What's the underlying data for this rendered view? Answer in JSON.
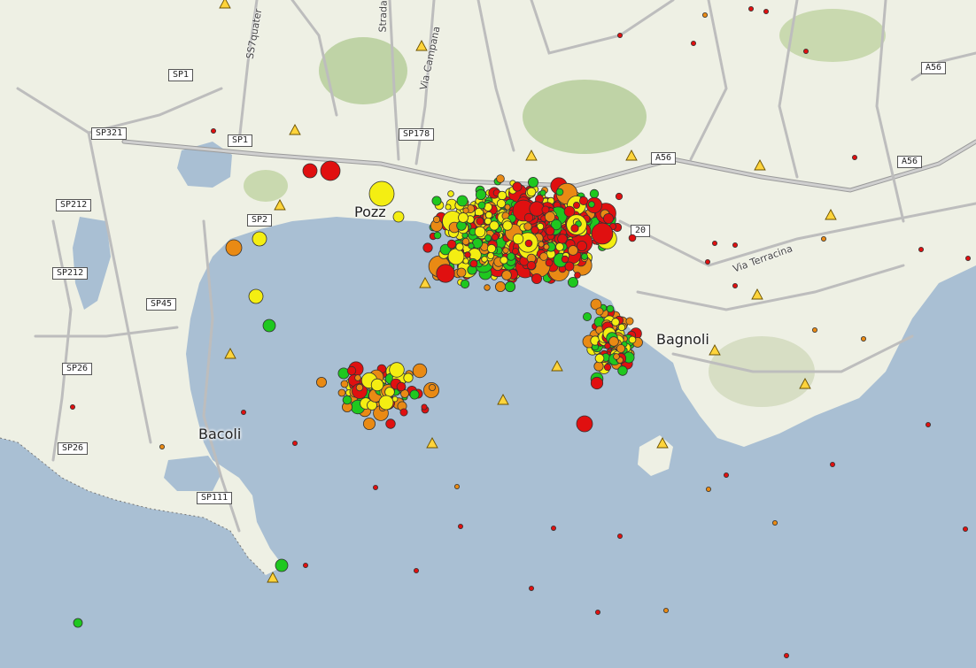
{
  "map": {
    "road_labels": [
      {
        "id": "sp1-a",
        "text": "SP1"
      },
      {
        "id": "sp1-b",
        "text": "SP1"
      },
      {
        "id": "sp321",
        "text": "SP321"
      },
      {
        "id": "sp212-a",
        "text": "SP212"
      },
      {
        "id": "sp212-b",
        "text": "SP212"
      },
      {
        "id": "sp2",
        "text": "SP2"
      },
      {
        "id": "sp45",
        "text": "SP45"
      },
      {
        "id": "sp26-a",
        "text": "SP26"
      },
      {
        "id": "sp26-b",
        "text": "SP26"
      },
      {
        "id": "sp111",
        "text": "SP111"
      },
      {
        "id": "sp178",
        "text": "SP178"
      },
      {
        "id": "a56-a",
        "text": "A56"
      },
      {
        "id": "a56-b",
        "text": "A56"
      },
      {
        "id": "a56-c",
        "text": "A56"
      },
      {
        "id": "road-20",
        "text": "20"
      }
    ],
    "place_labels": [
      {
        "id": "bacoli",
        "text": "Bacoli"
      },
      {
        "id": "bagnoli",
        "text": "Bagnoli"
      },
      {
        "id": "pozzuoli",
        "text": "Pozz"
      }
    ],
    "street_labels": [
      {
        "id": "ss7",
        "text": "SS7quater"
      },
      {
        "id": "strada",
        "text": "Stradale"
      },
      {
        "id": "campana",
        "text": "Via Campana"
      },
      {
        "id": "terracina",
        "text": "Via Terracina"
      }
    ],
    "colors": {
      "sea": "#a9bfd3",
      "land": "#eef0e4",
      "quake_red": "#e01010",
      "quake_orange": "#e98a14",
      "quake_yellow": "#f4ee12",
      "quake_green": "#1fc81f",
      "station_triangle": "#ffd43b"
    },
    "icons": {
      "earthquake_marker": "circle",
      "seismic_station": "triangle"
    }
  }
}
